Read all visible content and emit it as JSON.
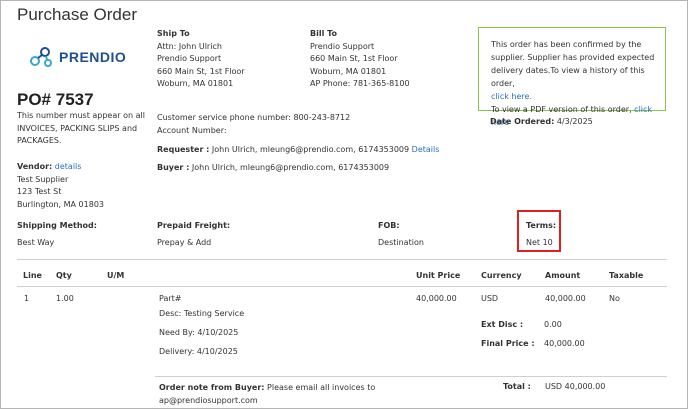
{
  "page": {
    "title": "Purchase Order"
  },
  "logo": {
    "text": "PRENDIO"
  },
  "po": {
    "number": "PO# 7537",
    "note_lines": [
      "This number must appear on all",
      "INVOICES, PACKING SLIPS and",
      "PACKAGES."
    ]
  },
  "vendor": {
    "label": "Vendor:",
    "details_link": "details",
    "lines": [
      "Test Supplier",
      "123 Test St",
      "Burlington, MA 01803"
    ]
  },
  "ship_to": {
    "label": "Ship To",
    "lines": [
      "Attn: John Ulrich",
      "Prendio Support",
      "660 Main St, 1st Floor",
      "Woburn, MA 01801"
    ]
  },
  "bill_to": {
    "label": "Bill To",
    "lines": [
      "Prendio Support",
      "660 Main St, 1st Floor",
      "Woburn, MA 01801",
      "AP Phone: 781-365-8100"
    ]
  },
  "confirmation": {
    "lines": [
      "This order has been confirmed by the",
      "supplier. Supplier has provided expected",
      "delivery dates.To view a history of this order,"
    ],
    "history_link": "click here.",
    "pdf_text": "To view a PDF version of this order,",
    "pdf_link": "click here"
  },
  "customer_service": {
    "phone_line": "Customer service phone number: 800-243-8712",
    "account_line": "Account Number:"
  },
  "date_ordered": {
    "label": "Date Ordered:",
    "value": "4/3/2025"
  },
  "requester": {
    "label": "Requester :",
    "value": "John Ulrich, mleung6@prendio.com, 6174353009",
    "details_link": "Details"
  },
  "buyer": {
    "label": "Buyer :",
    "value": "John Ulrich, mleung6@prendio.com, 6174353009"
  },
  "terms_row": {
    "shipping_method": {
      "label": "Shipping Method:",
      "value": "Best Way"
    },
    "prepaid_freight": {
      "label": "Prepaid Freight:",
      "value": "Prepay & Add"
    },
    "fob": {
      "label": "FOB:",
      "value": "Destination"
    },
    "terms": {
      "label": "Terms:",
      "value": "Net 10"
    }
  },
  "table": {
    "headers": {
      "line": "Line",
      "qty": "Qty",
      "um": "U/M",
      "unit_price": "Unit Price",
      "currency": "Currency",
      "amount": "Amount",
      "taxable": "Taxable"
    },
    "row": {
      "line": "1",
      "qty": "1.00",
      "um": "",
      "part": "Part#",
      "desc": "Desc: Testing Service",
      "need_by": "Need By: 4/10/2025",
      "delivery": "Delivery: 4/10/2025",
      "unit_price": "40,000.00",
      "currency": "USD",
      "amount": "40,000.00",
      "taxable": "No",
      "ext_disc_label": "Ext Disc :",
      "ext_disc_value": "0.00",
      "final_price_label": "Final Price :",
      "final_price_value": "40,000.00"
    }
  },
  "footer": {
    "note_label": "Order note from Buyer:",
    "note_line1": "Please email all invoices to",
    "note_line2": "ap@prendiosupport.com",
    "total_label": "Total :",
    "total_value": "USD 40,000.00"
  },
  "colors": {
    "link": "#2a6ebb",
    "highlight": "#e02020",
    "confirm_border": "#8bc34a",
    "logo": "#1d4f8f"
  }
}
